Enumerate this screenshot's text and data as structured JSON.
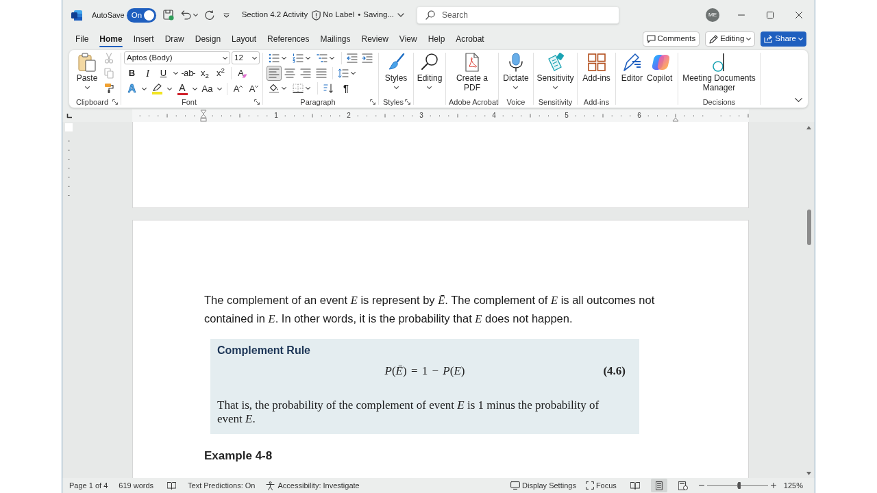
{
  "title_bar": {
    "autosave_label": "AutoSave",
    "autosave_toggle": {
      "label": "On",
      "on": true
    },
    "document_title": "Section 4.2 Activity",
    "sensitivity": "No Label",
    "separator": "•",
    "save_status": "Saving...",
    "search": {
      "placeholder": "Search"
    },
    "account_initials": "ME"
  },
  "menu_tabs": [
    {
      "label": "File",
      "selected": false
    },
    {
      "label": "Home",
      "selected": true
    },
    {
      "label": "Insert",
      "selected": false
    },
    {
      "label": "Draw",
      "selected": false
    },
    {
      "label": "Design",
      "selected": false
    },
    {
      "label": "Layout",
      "selected": false
    },
    {
      "label": "References",
      "selected": false
    },
    {
      "label": "Mailings",
      "selected": false
    },
    {
      "label": "Review",
      "selected": false
    },
    {
      "label": "View",
      "selected": false
    },
    {
      "label": "Help",
      "selected": false
    },
    {
      "label": "Acrobat",
      "selected": false
    }
  ],
  "header_buttons": [
    {
      "kind": "comments",
      "label": "Comments"
    },
    {
      "kind": "editing",
      "label": "Editing"
    },
    {
      "kind": "share",
      "label": "Share"
    }
  ],
  "ribbon": {
    "clipboard": {
      "paste": "Paste",
      "tools": [
        {
          "kind": "cut",
          "disabled": true
        },
        {
          "kind": "copy",
          "disabled": true
        },
        {
          "kind": "format_painter",
          "disabled": false
        }
      ],
      "label": "Clipboard",
      "launcher": true
    },
    "font": {
      "font_name": "Aptos (Body)",
      "font_size": "12",
      "row_1": [
        {
          "kind": "bold",
          "glyph": "B",
          "dropdown": false
        },
        {
          "kind": "italic",
          "glyph": "I",
          "dropdown": false
        },
        {
          "kind": "underline",
          "glyph": "U",
          "dropdown": true
        },
        {
          "kind": "strikethrough",
          "glyph": "ab",
          "dropdown": false
        },
        {
          "kind": "subscript",
          "glyph": "x$_{2}$",
          "dropdown": false
        },
        {
          "kind": "superscript",
          "glyph": "x$^{2}$",
          "dropdown": false
        },
        {
          "kind": "clear",
          "glyph": "A",
          "dropdown": false
        }
      ],
      "row_2": [
        {
          "kind": "effects",
          "glyph": "A",
          "dropdown": true
        },
        {
          "kind": "highlight",
          "color": "#f2e422",
          "dropdown": true
        },
        {
          "kind": "color",
          "glyph": "A",
          "color": "#d0202a",
          "dropdown": true
        },
        {
          "kind": "case",
          "glyph": "Aa",
          "dropdown": true
        },
        {
          "kind": "grow",
          "glyph": "A",
          "dropdown": false
        },
        {
          "kind": "shrink",
          "glyph": "A",
          "dropdown": false
        }
      ],
      "label": "Font",
      "launcher": true
    },
    "paragraph": {
      "row_1": [
        {
          "kind": "bullets",
          "dropdown": true
        },
        {
          "kind": "numbering",
          "dropdown": true
        },
        {
          "kind": "multilevel",
          "dropdown": true
        },
        {
          "kind": "outdent",
          "dropdown": false
        },
        {
          "kind": "indent",
          "dropdown": false
        }
      ],
      "alignment": [
        {
          "kind": "left",
          "selected": true
        },
        {
          "kind": "center",
          "selected": false
        },
        {
          "kind": "right",
          "selected": false
        },
        {
          "kind": "justify",
          "selected": false
        }
      ],
      "row_3": [
        {
          "kind": "shading",
          "dropdown": true
        },
        {
          "kind": "borders",
          "dropdown": true
        },
        {
          "kind": "sort",
          "dropdown": false
        },
        {
          "kind": "marks",
          "glyph": "¶",
          "dropdown": false
        }
      ],
      "label": "Paragraph",
      "launcher": true
    },
    "groups": [
      {
        "label": "Styles",
        "launcher": true,
        "buttons": [
          {
            "kind": "styles",
            "label": "Styles",
            "dropdown": true
          }
        ]
      },
      {
        "buttons": [
          {
            "kind": "search",
            "label": "Editing",
            "dropdown": true
          }
        ]
      },
      {
        "label": "Adobe Acrobat",
        "launcher": false,
        "buttons": [
          {
            "kind": "pdf",
            "label": "Create a PDF",
            "dropdown": false
          }
        ]
      },
      {
        "label": "Voice",
        "launcher": false,
        "buttons": [
          {
            "kind": "mic",
            "label": "Dictate",
            "dropdown": true
          }
        ]
      },
      {
        "label": "Sensitivity",
        "launcher": false,
        "buttons": [
          {
            "kind": "sensitivity",
            "label": "Sensitivity",
            "dropdown": true
          }
        ]
      },
      {
        "label": "Add-ins",
        "launcher": false,
        "buttons": [
          {
            "kind": "addins",
            "label": "Add-ins",
            "dropdown": false
          }
        ]
      },
      {
        "buttons": [
          {
            "kind": "editor",
            "label": "Editor",
            "dropdown": false
          },
          {
            "kind": "copilot",
            "label": "Copilot",
            "dropdown": false
          }
        ]
      },
      {
        "label": "Decisions",
        "launcher": false,
        "buttons": [
          {
            "kind": "decisions",
            "label": "Meeting Documents Manager",
            "dropdown": false
          }
        ]
      }
    ]
  },
  "ruler": {
    "numbers": [
      "1",
      "2",
      "3",
      "4",
      "5",
      "6"
    ]
  },
  "document": {
    "paragraph": "The complement of an event *E* is represent by *Ē*. The complement of *E* is all outcomes not contained in *E*. In other words, it is the probability that *E* does not happen.",
    "rule_box": {
      "title": "Complement Rule",
      "equation": "*P*(*Ē*) = 1 − *P*(*E*)",
      "equation_number": "(4.6)",
      "text": "That is, the probability of the complement of event *E* is 1 minus the probability of event *E*."
    },
    "heading": "Example 4-8"
  },
  "status_bar": {
    "page": "Page 1 of 4",
    "words": "619 words",
    "text_predictions": "Text Predictions: On",
    "accessibility": "Accessibility: Investigate",
    "display_settings": "Display Settings",
    "focus": "Focus",
    "views": [
      {
        "kind": "read",
        "selected": false
      },
      {
        "kind": "print",
        "selected": true
      },
      {
        "kind": "web",
        "selected": false
      }
    ],
    "zoom": {
      "level": 0.53,
      "reading": "125%"
    }
  }
}
